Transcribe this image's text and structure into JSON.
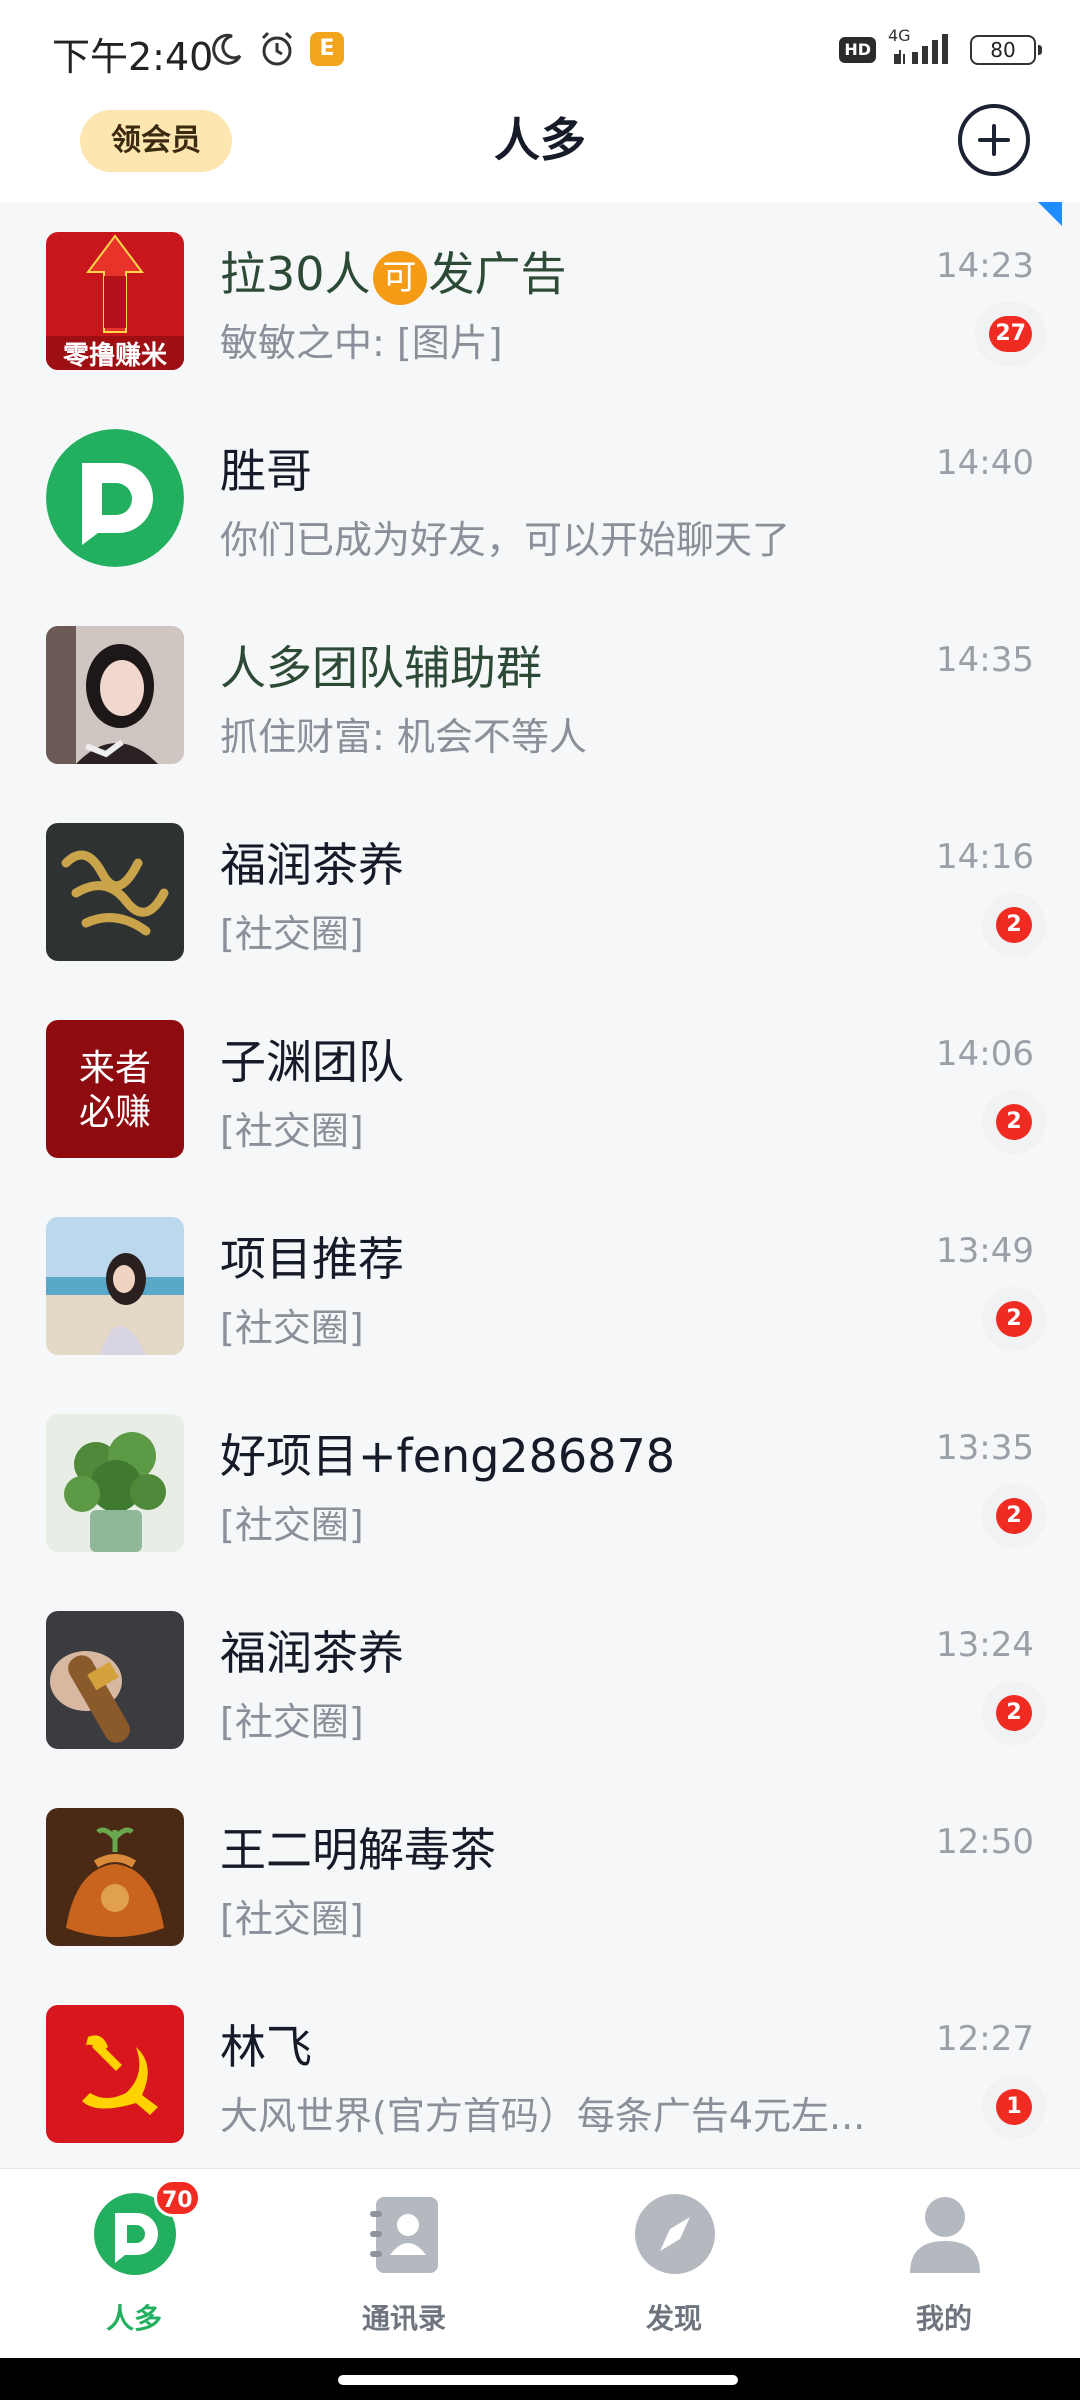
{
  "status_bar": {
    "time": "下午2:40",
    "network": "4G",
    "hd": "HD",
    "battery": "80",
    "app_icon_text": "E"
  },
  "header": {
    "vip_label": "领会员",
    "title": "人多"
  },
  "chats": [
    {
      "name_before": "拉30人",
      "name_icon": "可",
      "name_after": "发广告",
      "preview": "敏敏之中: [图片]",
      "time": "14:23",
      "badge": "27",
      "avatar": "red-poster"
    },
    {
      "name": "胜哥",
      "preview": "你们已成为好友，可以开始聊天了",
      "time": "14:40",
      "badge": "",
      "avatar": "green-logo"
    },
    {
      "name": "人多团队辅助群",
      "preview": "抓住财富: 机会不等人",
      "time": "14:35",
      "badge": "",
      "avatar": "girl-photo"
    },
    {
      "name": "福润茶养",
      "preview": "[社交圈]",
      "time": "14:16",
      "badge": "2",
      "avatar": "calligraphy"
    },
    {
      "name": "子渊团队",
      "preview": "[社交圈]",
      "time": "14:06",
      "badge": "2",
      "avatar": "red-text",
      "avatar_text": [
        "来者",
        "必赚"
      ]
    },
    {
      "name": "项目推荐",
      "preview": "[社交圈]",
      "time": "13:49",
      "badge": "2",
      "avatar": "beach-photo"
    },
    {
      "name": "好项目+feng286878",
      "preview": "[社交圈]",
      "time": "13:35",
      "badge": "2",
      "avatar": "plant-photo"
    },
    {
      "name": "福润茶养",
      "preview": "[社交圈]",
      "time": "13:24",
      "badge": "2",
      "avatar": "cigar-photo"
    },
    {
      "name": "王二明解毒茶",
      "preview": "[社交圈]",
      "time": "12:50",
      "badge": "",
      "avatar": "tea-bag-photo"
    },
    {
      "name": "林飞",
      "preview": "大风世界(官方首码）每条广告4元左...",
      "time": "12:27",
      "badge": "1",
      "avatar": "party-emblem"
    }
  ],
  "avatar_texts": {
    "poster_bottom": "零撸赚米"
  },
  "bottom_nav": {
    "items": [
      {
        "label": "人多",
        "badge": "70",
        "active": true
      },
      {
        "label": "通讯录"
      },
      {
        "label": "发现"
      },
      {
        "label": "我的"
      }
    ]
  },
  "colors": {
    "accent_green": "#22b060",
    "badge_red": "#f02b22",
    "vip_bg": "#fde6b0"
  }
}
